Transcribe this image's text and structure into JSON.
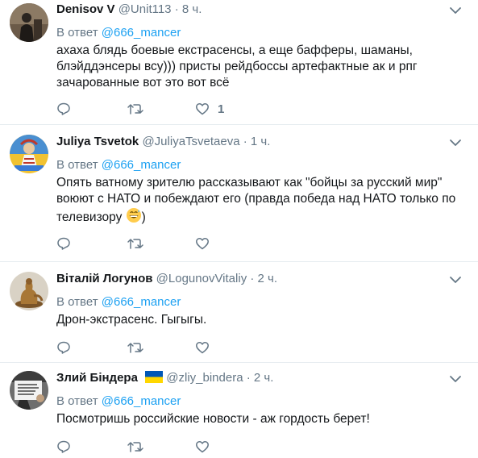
{
  "reply_prefix": "В ответ",
  "tweets": [
    {
      "name": "Denisov V",
      "handle": "@Unit113",
      "time": "8 ч.",
      "reply_to": "@666_mancer",
      "text": "ахаха блядь боевые екстрасенсы, а еще бафферы, шаманы, блэйддэнсеры всу))) присты рейдбоссы артефактные ак и рпг зачарованные вот это вот всё",
      "like_count": "1",
      "avatar_icon": "man-silhouette-avatar"
    },
    {
      "name": "Juliya Tsvetok",
      "handle": "@JuliyaTsvetaeva",
      "time": "1 ч.",
      "reply_to": "@666_mancer",
      "text_before": "Опять ватному зрителю рассказывают как \"бойцы за русский мир\" воюют с НАТО и побеждают его (правда победа над НАТО только по телевизору",
      "text_after": ")",
      "emoji": "grinning-sweat-face",
      "like_count": "",
      "avatar_icon": "ukraine-folk-doll-avatar"
    },
    {
      "name": "Віталій Логунов",
      "handle": "@LogunovVitaliy",
      "time": "2 ч.",
      "reply_to": "@666_mancer",
      "text": "Дрон-экстрасенс. Гыгыгы.",
      "like_count": "",
      "avatar_icon": "bronze-figure-avatar"
    },
    {
      "name": "Злий Біндера",
      "handle": "@zliy_bindera",
      "time": "2 ч.",
      "reply_to": "@666_mancer",
      "text": "Посмотришь российские новости - аж гордость берет!",
      "like_count": "",
      "avatar_icon": "protest-sign-avatar",
      "flag": "ukraine-flag-icon"
    }
  ],
  "colors": {
    "link": "#1da1f2",
    "muted": "#657786",
    "border": "#e6ecf0",
    "flag_blue": "#0057b7",
    "flag_yellow": "#ffd700"
  }
}
